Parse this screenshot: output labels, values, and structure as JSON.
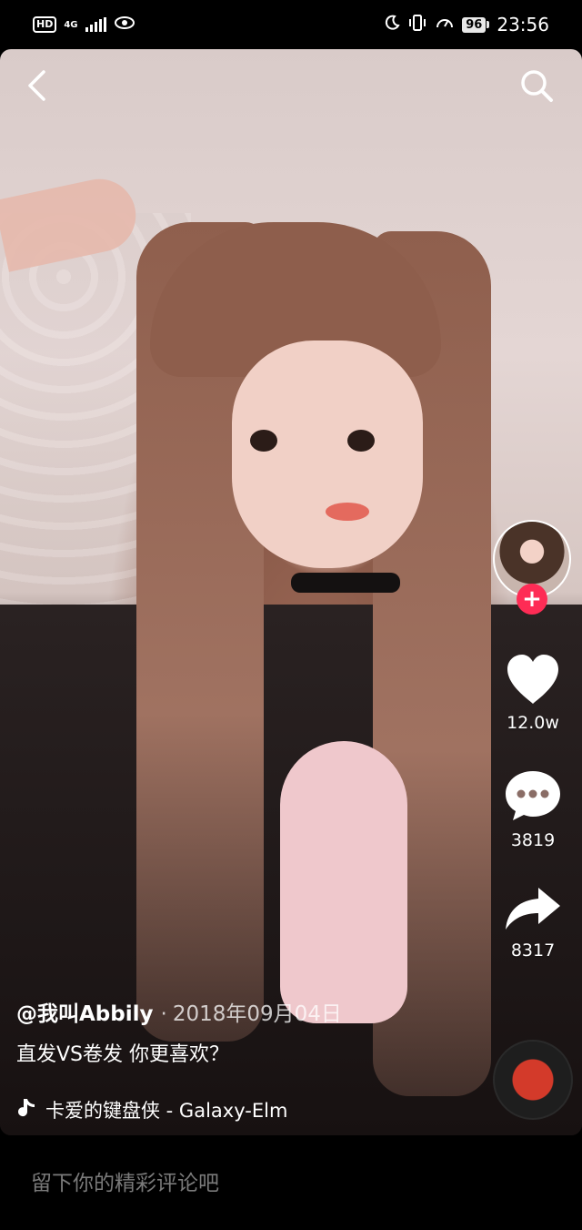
{
  "status_bar": {
    "hd": "HD",
    "network": "4G",
    "battery": "96",
    "time": "23:56"
  },
  "video": {
    "author": "@我叫Abbily",
    "separator": "·",
    "date": "2018年09月04日",
    "caption": "直发VS卷发  你更喜欢？",
    "music": "卡爱的键盘侠 - Galaxy-Elm",
    "like_count": "12.0w",
    "comment_count": "3819",
    "share_count": "8317"
  },
  "icons": {
    "back": "chevron-left-icon",
    "search": "search-icon",
    "like": "heart-icon",
    "comment": "speech-bubble-icon",
    "share": "share-arrow-icon",
    "music": "music-note-icon",
    "follow": "plus-icon"
  },
  "follow": {
    "plus": "+"
  },
  "comment_bar": {
    "placeholder": "留下你的精彩评论吧"
  },
  "colors": {
    "accent": "#fe2c55",
    "background": "#000000"
  }
}
